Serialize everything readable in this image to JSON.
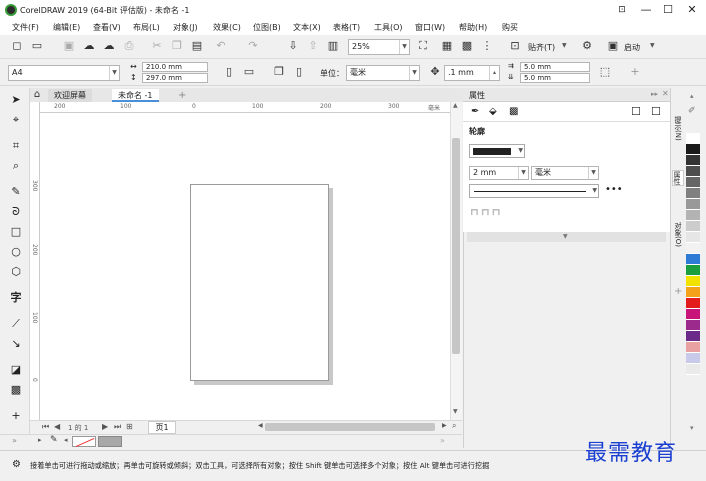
{
  "window": {
    "title": "CorelDRAW 2019 (64-Bit 评估版) - 未命名 -1",
    "minimize": "—",
    "maximize": "☐",
    "close": "✕",
    "restore": "⊡"
  },
  "menu": {
    "items": [
      "文件(F)",
      "编辑(E)",
      "查看(V)",
      "布局(L)",
      "对象(J)",
      "效果(C)",
      "位图(B)",
      "文本(X)",
      "表格(T)",
      "工具(O)",
      "窗口(W)",
      "帮助(H)",
      "购买"
    ]
  },
  "toolbar": {
    "zoom_value": "25%",
    "snap_label": "贴齐(T)",
    "launch_label": "启动"
  },
  "propertybar": {
    "page_size": "A4",
    "width": "210.0 mm",
    "height": "297.0 mm",
    "units_label": "单位：",
    "units_value": "毫米",
    "nudge": ".1 mm",
    "dup_x": "5.0 mm",
    "dup_y": "5.0 mm"
  },
  "tabs": {
    "welcome": "欢迎屏幕",
    "document": "未命名 -1",
    "add": "+"
  },
  "ruler": {
    "h_ticks": [
      "200",
      "100",
      "0",
      "100",
      "200",
      "300"
    ],
    "v_ticks": [
      "300",
      "200",
      "100",
      "0"
    ],
    "unit": "毫米"
  },
  "pagenav": {
    "page_count": "1 的 1",
    "page_tab": "页1"
  },
  "docker": {
    "title": "属性",
    "section": "轮廓",
    "outline_width": "2 mm",
    "outline_unit": "毫米"
  },
  "right_tabs": [
    "提示(N)",
    "属性",
    "对象(O)"
  ],
  "palette": {
    "colors": [
      "#ffffff",
      "#1a1a1a",
      "#333333",
      "#4d4d4d",
      "#666666",
      "#808080",
      "#999999",
      "#b3b3b3",
      "#cccccc",
      "#e6e6e6",
      "#f2f2f2",
      "#2e7bd6",
      "#1b9e3e",
      "#f2e200",
      "#f4a21a",
      "#e31c1c",
      "#c8157a",
      "#9b2a8c",
      "#6b2a8a",
      "#e9a1a1",
      "#c9c9e9",
      "#eaeaea"
    ]
  },
  "status": {
    "text": "接着单击可进行拖动或缩放；再单击可旋转或倾斜；双击工具，可选择所有对象；按住 Shift 键单击可选择多个对象；按住 Alt 键单击可进行挖掘"
  },
  "watermark": "最需教育"
}
